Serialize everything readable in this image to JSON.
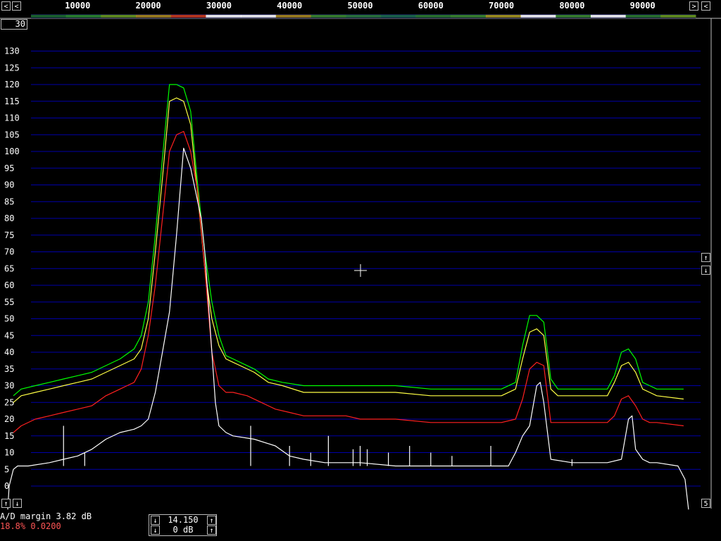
{
  "header": {
    "scroll_left_icon": "chevron-left-icon",
    "scroll_right_icon": "chevron-right-icon",
    "display_value": "30"
  },
  "controls": {
    "level_up_icon": "arrow-up-icon",
    "level_down_icon": "arrow-down-icon",
    "corner_right_label": "5"
  },
  "status": {
    "line1": "A/D margin 3.82 dB",
    "line2": "18.8% 0.0200"
  },
  "gain_box": {
    "value_top": "14.150",
    "value_bottom": "0 dB"
  },
  "colors": {
    "background": "#000000",
    "grid": "#0000a8",
    "max_hold": "#00ff00",
    "average_high": "#ffff44",
    "average_low": "#ff2020",
    "instant": "#ffffff"
  },
  "chart_data": {
    "type": "line",
    "x_range": [
      0,
      96000
    ],
    "ylim": [
      0,
      130
    ],
    "x_ticks": [
      10000,
      20000,
      30000,
      40000,
      50000,
      60000,
      70000,
      80000,
      90000
    ],
    "y_ticks": [
      0,
      5,
      10,
      15,
      20,
      25,
      30,
      35,
      40,
      45,
      50,
      55,
      60,
      65,
      70,
      75,
      80,
      85,
      90,
      95,
      100,
      105,
      110,
      115,
      120,
      125,
      130
    ],
    "grid": true,
    "series": [
      {
        "color": "#00ff00",
        "x": [
          900,
          2000,
          4000,
          6000,
          8000,
          10000,
          12000,
          14000,
          16000,
          18000,
          19000,
          20000,
          21000,
          22000,
          23000,
          24000,
          25000,
          26000,
          27000,
          28000,
          29000,
          30000,
          31000,
          32000,
          33000,
          35000,
          37000,
          39000,
          42000,
          46000,
          50000,
          55000,
          60000,
          65000,
          70000,
          72000,
          73000,
          74000,
          75000,
          76000,
          77000,
          78000,
          80000,
          85000,
          86000,
          87000,
          88000,
          89000,
          90000,
          91000,
          92000,
          95800
        ],
        "y": [
          27,
          29,
          30,
          31,
          32,
          33,
          34,
          36,
          38,
          41,
          45,
          55,
          75,
          98,
          120,
          120,
          119,
          112,
          90,
          70,
          55,
          45,
          39,
          38,
          37,
          35,
          32,
          31,
          30,
          30,
          30,
          30,
          29,
          29,
          29,
          31,
          42,
          51,
          51,
          49,
          32,
          29,
          29,
          29,
          33,
          40,
          41,
          38,
          31,
          30,
          29,
          29
        ]
      },
      {
        "color": "#ffff44",
        "x": [
          900,
          2000,
          4000,
          6000,
          8000,
          10000,
          12000,
          14000,
          16000,
          18000,
          19000,
          20000,
          21000,
          22000,
          23000,
          24000,
          25000,
          26000,
          27000,
          28000,
          29000,
          30000,
          31000,
          32000,
          33000,
          35000,
          37000,
          39000,
          42000,
          46000,
          50000,
          55000,
          60000,
          65000,
          70000,
          72000,
          73000,
          74000,
          75000,
          76000,
          77000,
          78000,
          80000,
          85000,
          86000,
          87000,
          88000,
          89000,
          90000,
          91000,
          92000,
          95800
        ],
        "y": [
          25,
          27,
          28,
          29,
          30,
          31,
          32,
          34,
          36,
          38,
          41,
          50,
          70,
          92,
          115,
          116,
          115,
          108,
          87,
          65,
          50,
          42,
          38,
          37,
          36,
          34,
          31,
          30,
          28,
          28,
          28,
          28,
          27,
          27,
          27,
          29,
          38,
          46,
          47,
          45,
          29,
          27,
          27,
          27,
          31,
          36,
          37,
          34,
          29,
          28,
          27,
          26
        ]
      },
      {
        "color": "#ff2020",
        "x": [
          900,
          2000,
          4000,
          6000,
          8000,
          10000,
          12000,
          14000,
          16000,
          17000,
          18000,
          19000,
          20000,
          21000,
          22000,
          23000,
          24000,
          25000,
          26000,
          27000,
          28000,
          29000,
          30000,
          31000,
          32000,
          34000,
          36000,
          38000,
          40000,
          42000,
          44000,
          46000,
          48000,
          50000,
          55000,
          60000,
          65000,
          70000,
          72000,
          73000,
          74000,
          75000,
          76000,
          77000,
          78000,
          80000,
          85000,
          86000,
          87000,
          88000,
          89000,
          90000,
          91000,
          92000,
          95800
        ],
        "y": [
          16,
          18,
          20,
          21,
          22,
          23,
          24,
          27,
          29,
          30,
          31,
          35,
          45,
          60,
          80,
          100,
          105,
          106,
          100,
          88,
          65,
          40,
          30,
          28,
          28,
          27,
          25,
          23,
          22,
          21,
          21,
          21,
          21,
          20,
          20,
          19,
          19,
          19,
          20,
          26,
          35,
          37,
          36,
          19,
          19,
          19,
          19,
          21,
          26,
          27,
          24,
          20,
          19,
          19,
          18
        ]
      },
      {
        "color": "#ffffff",
        "x": [
          100,
          300,
          900,
          1500,
          3000,
          6000,
          8000,
          10000,
          12000,
          14000,
          16000,
          18000,
          19000,
          20000,
          21000,
          22000,
          23000,
          24000,
          25000,
          26000,
          27000,
          27500,
          28000,
          28500,
          29000,
          29500,
          30000,
          31000,
          32000,
          35000,
          38000,
          40000,
          42000,
          45000,
          50000,
          55000,
          60000,
          65000,
          70000,
          71000,
          72000,
          73000,
          74000,
          75000,
          75500,
          76000,
          77000,
          80000,
          85000,
          87000,
          88000,
          88500,
          89000,
          90000,
          91000,
          92000,
          95000,
          96000,
          96500
        ],
        "y": [
          -7,
          0,
          5,
          6,
          6,
          7,
          8,
          9,
          11,
          14,
          16,
          17,
          18,
          20,
          28,
          40,
          52,
          75,
          101,
          95,
          85,
          80,
          70,
          55,
          40,
          25,
          18,
          16,
          15,
          14,
          12,
          9,
          8,
          7,
          7,
          6,
          6,
          6,
          6,
          6,
          10,
          15,
          18,
          30,
          31,
          25,
          8,
          7,
          7,
          8,
          20,
          21,
          11,
          8,
          7,
          7,
          6,
          2,
          -7
        ]
      }
    ]
  }
}
